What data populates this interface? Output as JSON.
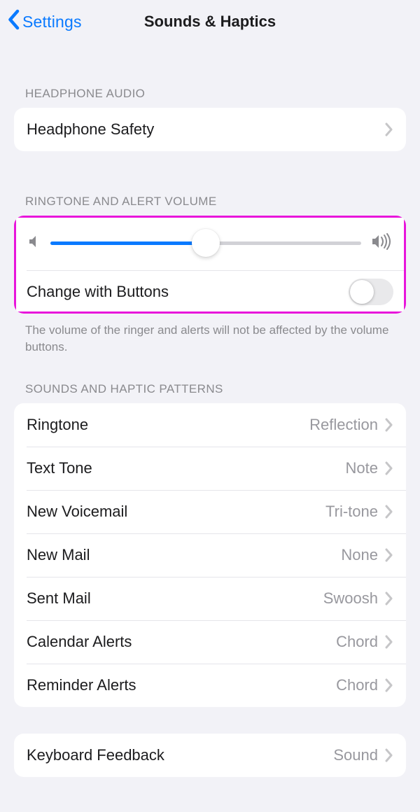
{
  "nav": {
    "back_label": "Settings",
    "title": "Sounds & Haptics"
  },
  "headphone": {
    "header": "HEADPHONE AUDIO",
    "safety_label": "Headphone Safety"
  },
  "volume": {
    "header": "RINGTONE AND ALERT VOLUME",
    "slider_percent": 50,
    "change_with_buttons_label": "Change with Buttons",
    "change_with_buttons_on": false,
    "footer": "The volume of the ringer and alerts will not be affected by the volume buttons."
  },
  "patterns": {
    "header": "SOUNDS AND HAPTIC PATTERNS",
    "items": [
      {
        "label": "Ringtone",
        "value": "Reflection"
      },
      {
        "label": "Text Tone",
        "value": "Note"
      },
      {
        "label": "New Voicemail",
        "value": "Tri-tone"
      },
      {
        "label": "New Mail",
        "value": "None"
      },
      {
        "label": "Sent Mail",
        "value": "Swoosh"
      },
      {
        "label": "Calendar Alerts",
        "value": "Chord"
      },
      {
        "label": "Reminder Alerts",
        "value": "Chord"
      }
    ]
  },
  "keyboard": {
    "label": "Keyboard Feedback",
    "value": "Sound"
  }
}
